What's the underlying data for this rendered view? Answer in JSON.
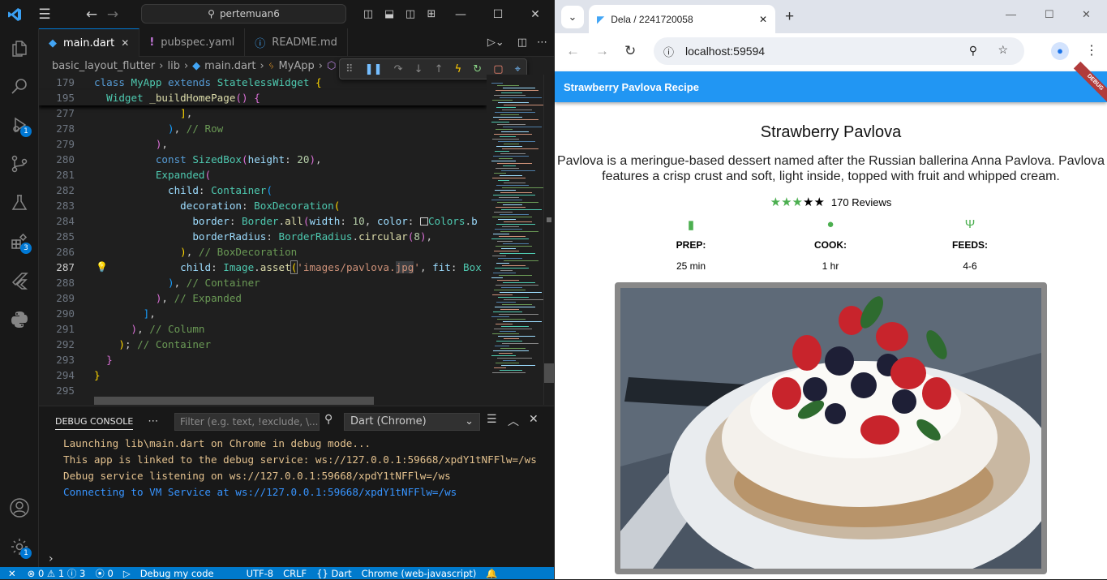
{
  "vscode": {
    "title_search": "pertemuan6",
    "tabs": [
      {
        "label": "main.dart",
        "active": true
      },
      {
        "label": "pubspec.yaml",
        "active": false
      },
      {
        "label": "README.md",
        "active": false
      }
    ],
    "breadcrumb": [
      "basic_layout_flutter",
      "lib",
      "main.dart",
      "MyApp",
      "_b"
    ],
    "badges": {
      "run_debug": "1",
      "extensions": "3",
      "settings": "1"
    },
    "code_lines": [
      {
        "n": "179",
        "html": "<span class=\"kw\">class</span> <span class=\"ty\">MyApp</span> <span class=\"kw\">extends</span> <span class=\"ty\">StatelessWidget</span> <span class=\"p1\">{</span>"
      },
      {
        "n": "195",
        "html": "  <span class=\"ty\">Widget</span> <span class=\"fn\">_buildHomePage</span><span class=\"p2\">()</span> <span class=\"p2\">{</span>"
      },
      {
        "n": "277",
        "html": "              <span class=\"p1\">]</span>,"
      },
      {
        "n": "278",
        "html": "            <span class=\"p3\">)</span>, <span class=\"cm\">// Row</span>"
      },
      {
        "n": "279",
        "html": "          <span class=\"p2\">)</span>,"
      },
      {
        "n": "280",
        "html": "          <span class=\"kw\">const</span> <span class=\"ty\">SizedBox</span><span class=\"p2\">(</span><span class=\"pr\">height</span>: <span class=\"nu\">20</span><span class=\"p2\">)</span>,"
      },
      {
        "n": "281",
        "html": "          <span class=\"ty\">Expanded</span><span class=\"p2\">(</span>"
      },
      {
        "n": "282",
        "html": "            <span class=\"pr\">child</span>: <span class=\"ty\">Container</span><span class=\"p3\">(</span>"
      },
      {
        "n": "283",
        "html": "              <span class=\"pr\">decoration</span>: <span class=\"ty\">BoxDecoration</span><span class=\"p1\">(</span>"
      },
      {
        "n": "284",
        "html": "                <span class=\"pr\">border</span>: <span class=\"ty\">Border</span>.<span class=\"fn\">all</span><span class=\"p2\">(</span><span class=\"pr\">width</span>: <span class=\"nu\">10</span>, <span class=\"pr\">color</span>: <span style=\"border:1px solid #ccc;display:inline-block;width:10px;height:10px;vertical-align:-1px\"></span><span class=\"ty\">Colors</span>.<span class=\"pr\">b</span>"
      },
      {
        "n": "285",
        "html": "                <span class=\"pr\">borderRadius</span>: <span class=\"ty\">BorderRadius</span>.<span class=\"fn\">circular</span><span class=\"p2\">(</span><span class=\"nu\">8</span><span class=\"p2\">)</span>,"
      },
      {
        "n": "286",
        "html": "              <span class=\"p1\">)</span>, <span class=\"cm\">// BoxDecoration</span>"
      },
      {
        "n": "287",
        "html": "              <span class=\"pr\">child</span>: <span class=\"ty\">Image</span>.<span class=\"fn\">asset</span><span class=\"p1\" style=\"outline:1px solid #888\">(</span><span class=\"st\">'images/pavlova.<span style=\"background:#3a3d41\">jpg</span>'</span>, <span class=\"pr\">fit</span>: <span class=\"ty\">Box</span>"
      },
      {
        "n": "288",
        "html": "            <span class=\"p3\">)</span>, <span class=\"cm\">// Container</span>"
      },
      {
        "n": "289",
        "html": "          <span class=\"p2\">)</span>, <span class=\"cm\">// Expanded</span>"
      },
      {
        "n": "290",
        "html": "        <span class=\"p3\">]</span>,"
      },
      {
        "n": "291",
        "html": "      <span class=\"p2\">)</span>, <span class=\"cm\">// Column</span>"
      },
      {
        "n": "292",
        "html": "    <span class=\"p1\">)</span>; <span class=\"cm\">// Container</span>"
      },
      {
        "n": "293",
        "html": "  <span class=\"p2\">}</span>"
      },
      {
        "n": "294",
        "html": "<span class=\"p1\">}</span>"
      },
      {
        "n": "295",
        "html": ""
      }
    ],
    "panel": {
      "title": "DEBUG CONSOLE",
      "filter_placeholder": "Filter (e.g. text, !exclude, \\...",
      "selected_target": "Dart (Chrome)",
      "console": [
        {
          "text": "Launching lib\\main.dart on Chrome in debug mode...",
          "color": "y"
        },
        {
          "text": "This app is linked to the debug service: ws://127.0.0.1:59668/xpdY1tNFFlw=/ws",
          "color": "y"
        },
        {
          "text": "Debug service listening on ws://127.0.0.1:59668/xpdY1tNFFlw=/ws",
          "color": "y"
        },
        {
          "text": "Connecting to VM Service at ws://127.0.0.1:59668/xpdY1tNFFlw=/ws",
          "color": "b"
        }
      ]
    },
    "status": {
      "errors": "0",
      "warnings": "1",
      "infos": "3",
      "ports": "0",
      "debug_my_code": "Debug my code",
      "encoding": "UTF-8",
      "eol": "CRLF",
      "language": "Dart",
      "device": "Chrome (web-javascript)"
    }
  },
  "browser": {
    "tab_title": "Dela / 2241720058",
    "url": "localhost:59594",
    "appbar_title": "Strawberry Pavlova Recipe",
    "debug_ribbon": "DEBUG",
    "recipe": {
      "title": "Strawberry Pavlova",
      "description": "Pavlova is a meringue-based dessert named after the Russian ballerina Anna Pavlova. Pavlova features a crisp crust and soft, light inside, topped with fruit and whipped cream.",
      "rating_filled": 3,
      "rating_total": 5,
      "reviews": "170 Reviews",
      "info": [
        {
          "label": "PREP:",
          "value": "25 min",
          "icon": "kitchen-icon"
        },
        {
          "label": "COOK:",
          "value": "1 hr",
          "icon": "timer-icon"
        },
        {
          "label": "FEEDS:",
          "value": "4-6",
          "icon": "restaurant-icon"
        }
      ]
    },
    "colors": {
      "accent": "#2196f3",
      "star_green": "#4caf50"
    }
  }
}
